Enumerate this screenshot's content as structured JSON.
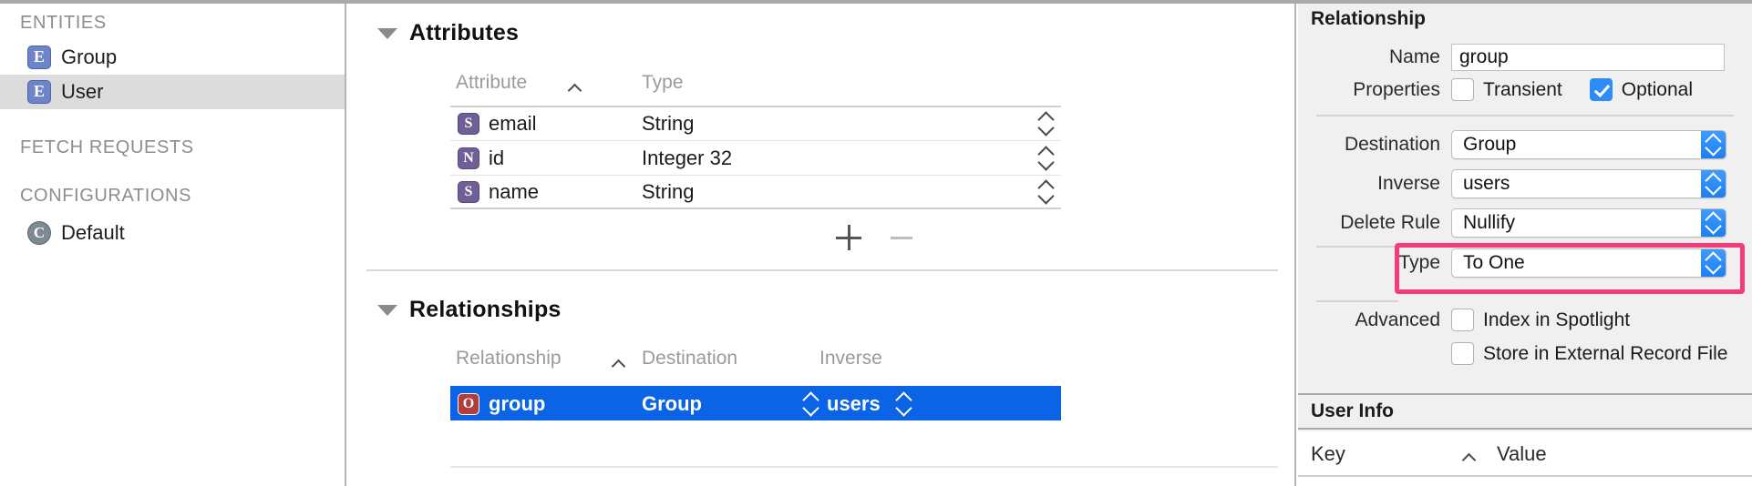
{
  "sidebar": {
    "groups": [
      {
        "title": "ENTITIES",
        "items": [
          {
            "label": "Group",
            "icon": "entity-icon",
            "glyph": "E",
            "selected": false
          },
          {
            "label": "User",
            "icon": "entity-icon",
            "glyph": "E",
            "selected": true
          }
        ]
      },
      {
        "title": "FETCH REQUESTS",
        "items": []
      },
      {
        "title": "CONFIGURATIONS",
        "items": [
          {
            "label": "Default",
            "icon": "configuration-icon",
            "glyph": "C",
            "selected": false
          }
        ]
      }
    ]
  },
  "editor": {
    "attributes_section": {
      "title": "Attributes",
      "disclosure": "expanded",
      "columns": [
        "Attribute",
        "Type"
      ],
      "sort_column": "Attribute",
      "sort_direction": "ascending",
      "rows": [
        {
          "glyph": "S",
          "name": "email",
          "type": "String"
        },
        {
          "glyph": "N",
          "name": "id",
          "type": "Integer 32"
        },
        {
          "glyph": "S",
          "name": "name",
          "type": "String"
        }
      ],
      "add_label": "+",
      "remove_label": "—"
    },
    "relationships_section": {
      "title": "Relationships",
      "disclosure": "expanded",
      "columns": [
        "Relationship",
        "Destination",
        "Inverse"
      ],
      "sort_column": "Relationship",
      "sort_direction": "ascending",
      "rows": [
        {
          "glyph": "O",
          "name": "group",
          "destination": "Group",
          "inverse": "users",
          "selected": true
        }
      ]
    }
  },
  "inspector": {
    "title": "Relationship",
    "name_label": "Name",
    "name_value": "group",
    "properties_label": "Properties",
    "properties": [
      {
        "label": "Transient",
        "checked": false
      },
      {
        "label": "Optional",
        "checked": true
      }
    ],
    "destination_label": "Destination",
    "destination_value": "Group",
    "inverse_label": "Inverse",
    "inverse_value": "users",
    "delete_rule_label": "Delete Rule",
    "delete_rule_value": "Nullify",
    "type_label": "Type",
    "type_value": "To One",
    "type_highlighted": true,
    "advanced_label": "Advanced",
    "advanced": [
      {
        "label": "Index in Spotlight",
        "checked": false
      },
      {
        "label": "Store in External Record File",
        "checked": false
      }
    ],
    "user_info": {
      "title": "User Info",
      "columns": [
        "Key",
        "Value"
      ],
      "sort_column": "Key",
      "sort_direction": "ascending",
      "rows": []
    }
  },
  "colors": {
    "selection_blue": "#0b63e5",
    "highlight_pink": "#f73a78",
    "checkbox_blue": "#2d8cf5",
    "entity_icon": "#6e84c8",
    "attribute_icon": "#6f5f96",
    "relationship_icon": "#b33c3c",
    "sidebar_selected": "#dcdcdc",
    "inspector_bg": "#f0f0f0"
  }
}
